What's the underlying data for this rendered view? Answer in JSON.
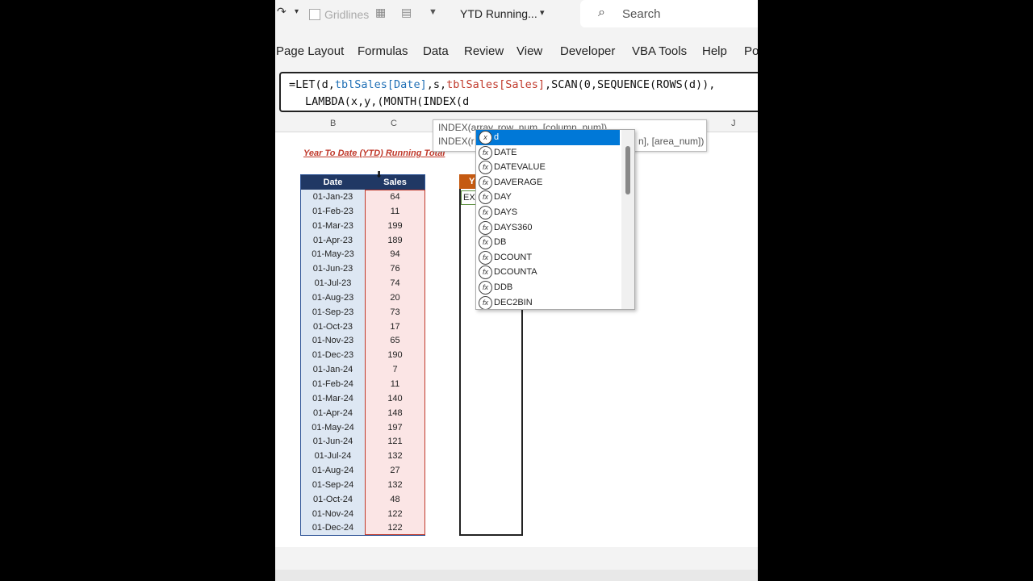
{
  "titlebar": {
    "gridlines_label": "Gridlines",
    "doc_title": "YTD Running...",
    "search_placeholder": "Search"
  },
  "ribbon": {
    "tabs": [
      "Page Layout",
      "Formulas",
      "Data",
      "Review",
      "View",
      "Developer",
      "VBA Tools",
      "Help",
      "Po"
    ]
  },
  "formula_bar": {
    "line1": {
      "p1": "=LET(d,",
      "r1": "tblSales[Date]",
      "p2": ",s,",
      "r2": "tblSales[Sales]",
      "p3": ",SCAN(0,SEQUENCE(ROWS(d)),"
    },
    "line2": "LAMBDA(x,y,(MONTH(INDEX(d"
  },
  "column_headers": [
    "B",
    "C",
    "J"
  ],
  "sheet": {
    "title": "Year To Date (YTD) Running Total",
    "table": {
      "headers": {
        "date": "Date",
        "sales": "Sales"
      },
      "rows": [
        {
          "date": "01-Jan-23",
          "sales": "64"
        },
        {
          "date": "01-Feb-23",
          "sales": "11"
        },
        {
          "date": "01-Mar-23",
          "sales": "199"
        },
        {
          "date": "01-Apr-23",
          "sales": "189"
        },
        {
          "date": "01-May-23",
          "sales": "94"
        },
        {
          "date": "01-Jun-23",
          "sales": "76"
        },
        {
          "date": "01-Jul-23",
          "sales": "74"
        },
        {
          "date": "01-Aug-23",
          "sales": "20"
        },
        {
          "date": "01-Sep-23",
          "sales": "73"
        },
        {
          "date": "01-Oct-23",
          "sales": "17"
        },
        {
          "date": "01-Nov-23",
          "sales": "65"
        },
        {
          "date": "01-Dec-23",
          "sales": "190"
        },
        {
          "date": "01-Jan-24",
          "sales": "7"
        },
        {
          "date": "01-Feb-24",
          "sales": "11"
        },
        {
          "date": "01-Mar-24",
          "sales": "140"
        },
        {
          "date": "01-Apr-24",
          "sales": "148"
        },
        {
          "date": "01-May-24",
          "sales": "197"
        },
        {
          "date": "01-Jun-24",
          "sales": "121"
        },
        {
          "date": "01-Jul-24",
          "sales": "132"
        },
        {
          "date": "01-Aug-24",
          "sales": "27"
        },
        {
          "date": "01-Sep-24",
          "sales": "132"
        },
        {
          "date": "01-Oct-24",
          "sales": "48"
        },
        {
          "date": "01-Nov-24",
          "sales": "122"
        },
        {
          "date": "01-Dec-24",
          "sales": "122"
        }
      ]
    },
    "ytd_header": "Y",
    "ytd_cell": "EXI"
  },
  "tooltip": {
    "line1": "INDEX(array, row_num, [column_num])",
    "line2_left": "INDEX(r",
    "line2_right": "n], [area_num])"
  },
  "autocomplete": {
    "items": [
      {
        "label": "d",
        "icon": "variable-icon",
        "selected": true
      },
      {
        "label": "DATE",
        "icon": "function-icon"
      },
      {
        "label": "DATEVALUE",
        "icon": "function-icon"
      },
      {
        "label": "DAVERAGE",
        "icon": "function-icon"
      },
      {
        "label": "DAY",
        "icon": "function-icon"
      },
      {
        "label": "DAYS",
        "icon": "function-icon"
      },
      {
        "label": "DAYS360",
        "icon": "function-icon"
      },
      {
        "label": "DB",
        "icon": "function-icon"
      },
      {
        "label": "DCOUNT",
        "icon": "function-icon"
      },
      {
        "label": "DCOUNTA",
        "icon": "function-icon"
      },
      {
        "label": "DDB",
        "icon": "function-icon"
      },
      {
        "label": "DEC2BIN",
        "icon": "function-icon"
      }
    ]
  },
  "colors": {
    "accent_blue": "#0078d7",
    "table_header": "#203864",
    "ytd_header": "#c55a11",
    "title_red": "#c0392b"
  }
}
